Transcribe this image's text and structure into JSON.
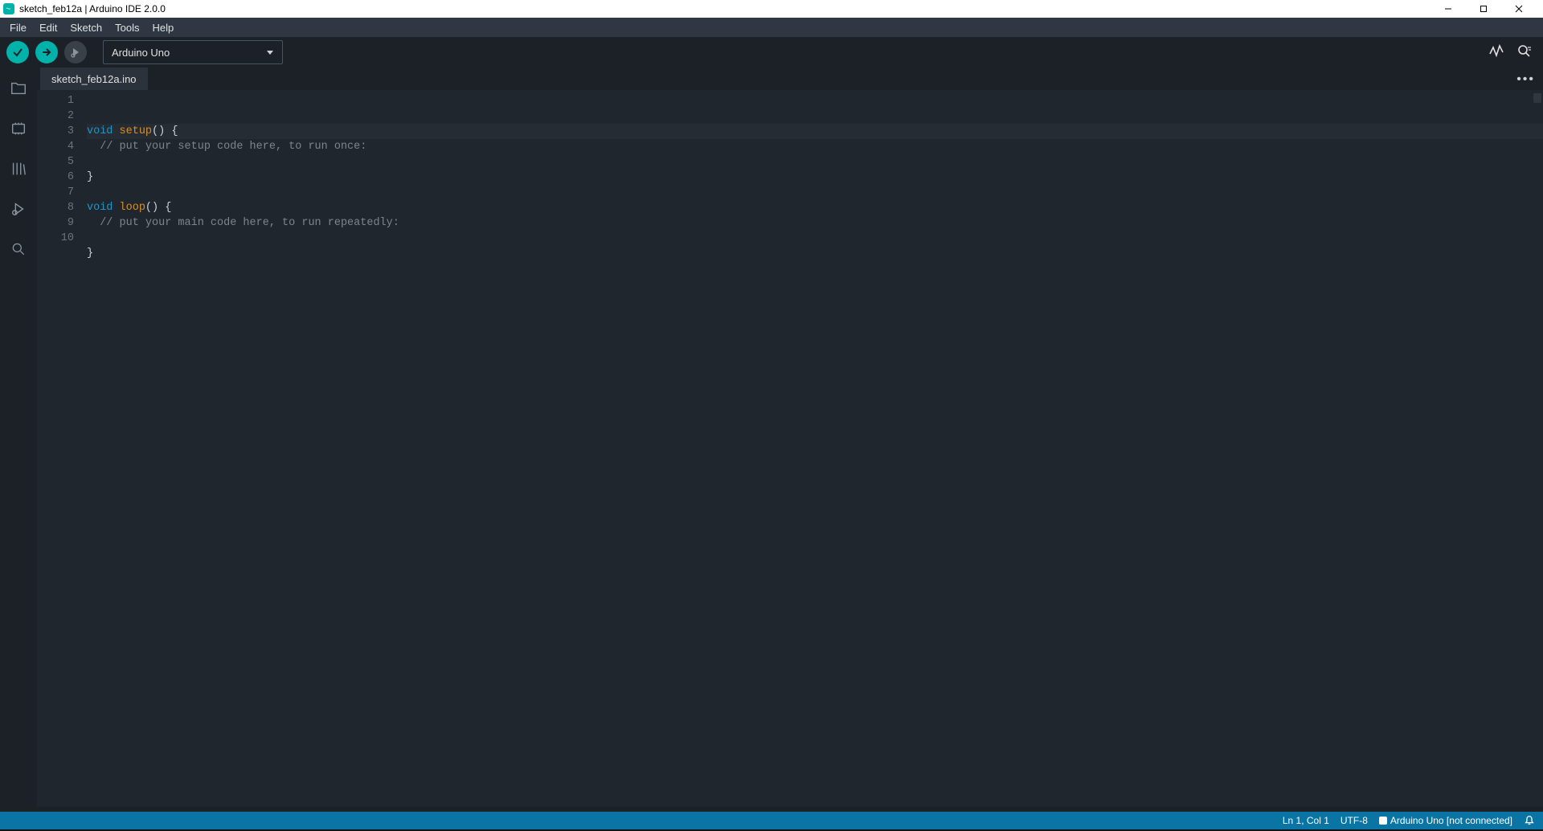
{
  "titlebar": {
    "title": "sketch_feb12a | Arduino IDE 2.0.0"
  },
  "menubar": {
    "items": [
      "File",
      "Edit",
      "Sketch",
      "Tools",
      "Help"
    ]
  },
  "toolbar": {
    "board_selected": "Arduino Uno"
  },
  "tab": {
    "filename": "sketch_feb12a.ino"
  },
  "editor": {
    "lines": [
      {
        "n": 1,
        "tokens": [
          [
            "kw",
            "void"
          ],
          [
            "sp",
            " "
          ],
          [
            "fn",
            "setup"
          ],
          [
            "pn",
            "()"
          ],
          [
            "sp",
            " "
          ],
          [
            "br",
            "{"
          ]
        ]
      },
      {
        "n": 2,
        "tokens": [
          [
            "sp",
            "  "
          ],
          [
            "cm",
            "// put your setup code here, to run once:"
          ]
        ]
      },
      {
        "n": 3,
        "tokens": []
      },
      {
        "n": 4,
        "tokens": [
          [
            "br",
            "}"
          ]
        ]
      },
      {
        "n": 5,
        "tokens": []
      },
      {
        "n": 6,
        "tokens": [
          [
            "kw",
            "void"
          ],
          [
            "sp",
            " "
          ],
          [
            "fn",
            "loop"
          ],
          [
            "pn",
            "()"
          ],
          [
            "sp",
            " "
          ],
          [
            "br",
            "{"
          ]
        ]
      },
      {
        "n": 7,
        "tokens": [
          [
            "sp",
            "  "
          ],
          [
            "cm",
            "// put your main code here, to run repeatedly:"
          ]
        ]
      },
      {
        "n": 8,
        "tokens": []
      },
      {
        "n": 9,
        "tokens": [
          [
            "br",
            "}"
          ]
        ]
      },
      {
        "n": 10,
        "tokens": []
      }
    ]
  },
  "statusbar": {
    "cursor": "Ln 1, Col 1",
    "encoding": "UTF-8",
    "board": "Arduino Uno [not connected]"
  }
}
